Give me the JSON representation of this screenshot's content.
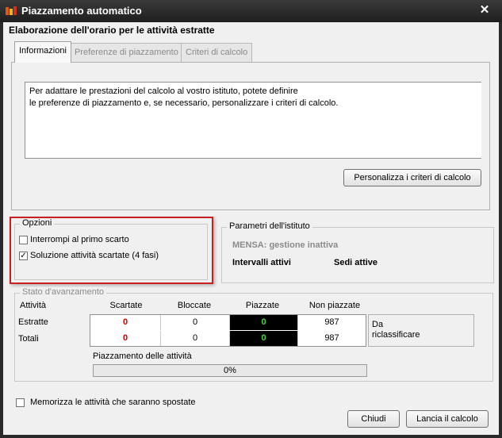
{
  "window": {
    "title": "Piazzamento automatico",
    "close_symbol": "✕"
  },
  "heading": "Elaborazione dell'orario per le attività estratte",
  "tabs": [
    {
      "label": "Informazioni",
      "active": true
    },
    {
      "label": "Preferenze di piazzamento",
      "active": false
    },
    {
      "label": "Criteri di calcolo",
      "active": false
    }
  ],
  "info": {
    "line1": "Per adattare le prestazioni del calcolo al vostro istituto, potete definire",
    "line2": "le preferenze di piazzamento e, se necessario, personalizzare i criteri di calcolo."
  },
  "buttons": {
    "customize": "Personalizza i criteri di calcolo",
    "close": "Chiudi",
    "launch": "Lancia il calcolo"
  },
  "opzioni": {
    "legend": "Opzioni",
    "items": [
      {
        "label": "Interrompi al primo scarto",
        "checked": false
      },
      {
        "label": "Soluzione attività scartate (4 fasi)",
        "checked": true
      }
    ],
    "check_mark": "✓"
  },
  "parametri": {
    "legend": "Parametri dell'istituto",
    "mensa": "MENSA: gestione inattiva",
    "intervalli": "Intervalli attivi",
    "sedi": "Sedi attive"
  },
  "stato": {
    "legend": "Stato d'avanzamento",
    "columns": {
      "attivita": "Attività",
      "scartate": "Scartate",
      "bloccate": "Bloccate",
      "piazzate": "Piazzate",
      "non_piazzate": "Non piazzate"
    },
    "rows": [
      {
        "label": "Estratte",
        "scartate": "0",
        "bloccate": "0",
        "piazzate": "0",
        "non_piazzate": "987"
      },
      {
        "label": "Totali",
        "scartate": "0",
        "bloccate": "0",
        "piazzate": "0",
        "non_piazzate": "987"
      }
    ],
    "da_line1": "Da",
    "da_line2": "riclassificare",
    "progress_label": "Piazzamento delle attività",
    "progress_value": 0,
    "progress_text": "0%"
  },
  "memorizza": {
    "label": "Memorizza le attività che saranno spostate",
    "checked": false
  },
  "colors": {
    "highlight": "#c82020",
    "scartate_text": "#d00000",
    "piazzate_bg": "#000000",
    "piazzate_text": "#3fdc3f"
  },
  "icons": [
    "app-logo-icon",
    "close-icon",
    "checkbox-checked-icon"
  ]
}
